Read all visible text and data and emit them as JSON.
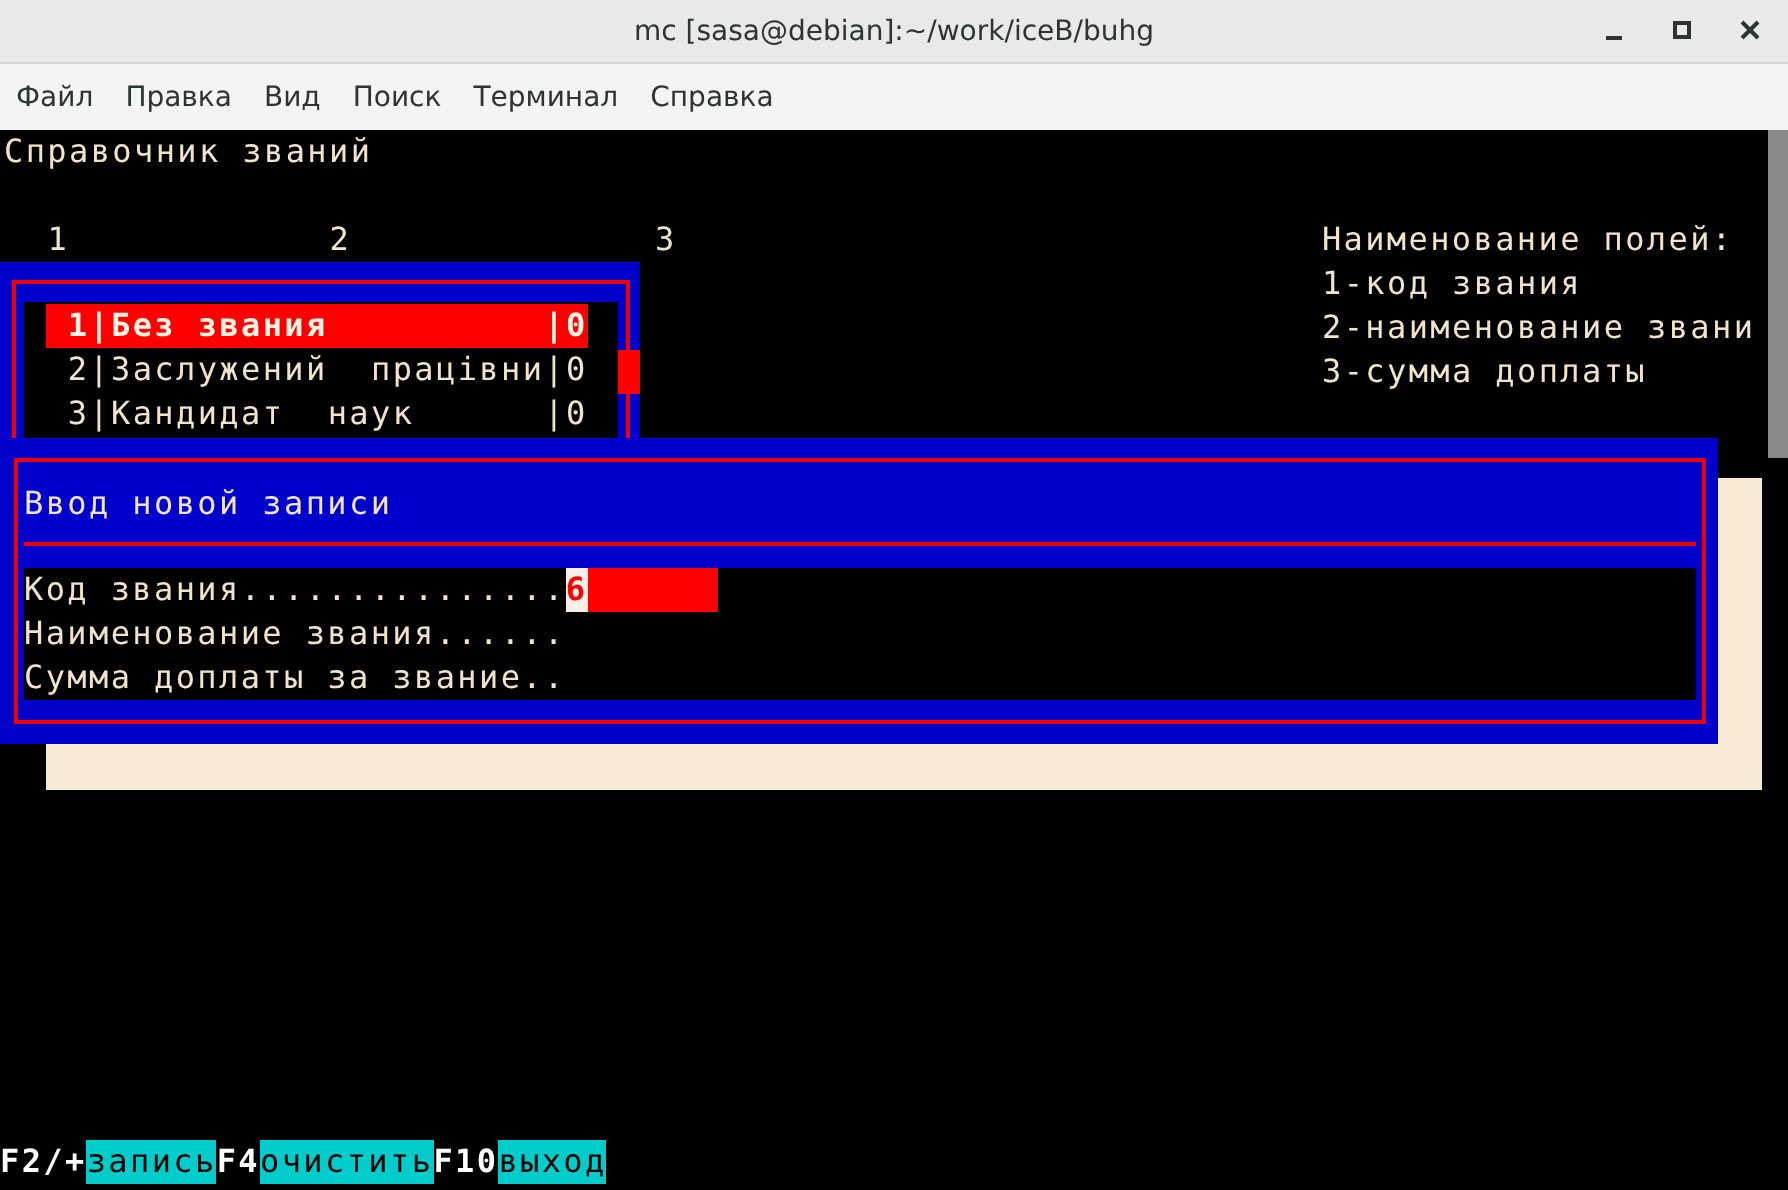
{
  "window": {
    "title": "mc [sasa@debian]:~/work/iceB/buhg"
  },
  "menu": [
    "Файл",
    "Правка",
    "Вид",
    "Поиск",
    "Терминал",
    "Справка"
  ],
  "terminal": {
    "heading": "Справочник званий",
    "column_numbers": [
      "1",
      "2",
      "3"
    ],
    "field_legend": [
      "Наименование полей:",
      "1-код звания",
      "2-наименование звани",
      "3-сумма доплаты"
    ],
    "list": {
      "rows": [
        {
          "text": "1|Без звания          |0",
          "selected": true
        },
        {
          "text": "2|Заслужений  працівни|0",
          "selected": false
        },
        {
          "text": "3|Кандидат  наук      |0",
          "selected": false
        }
      ]
    },
    "dialog": {
      "title": "Ввод новой записи",
      "fields": [
        {
          "label": "Код звания...............",
          "value": "6",
          "focused": true
        },
        {
          "label": "Наименование звания......",
          "focused": false
        },
        {
          "label": "Сумма доплаты за звание..",
          "focused": false
        }
      ]
    },
    "keys": [
      {
        "key": "F2/+",
        "label": "запись"
      },
      {
        "key": "F4",
        "label": "очистить"
      },
      {
        "key": "F10",
        "label": "выход"
      }
    ]
  }
}
